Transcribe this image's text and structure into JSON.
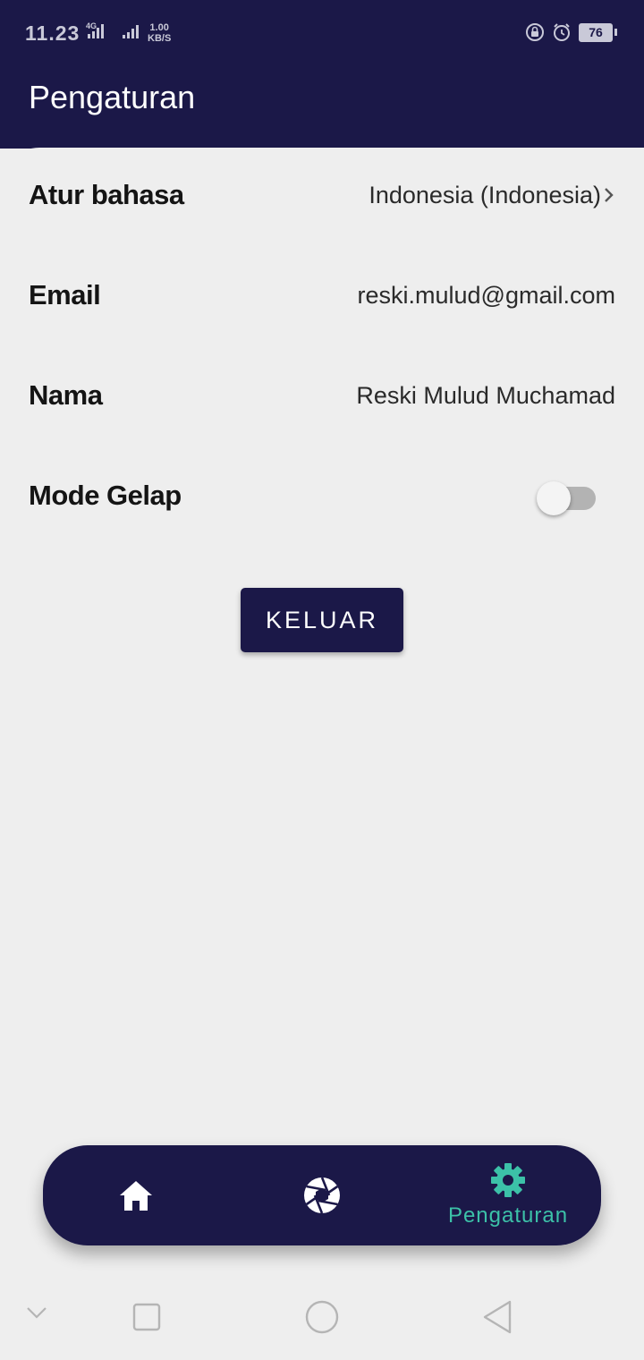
{
  "status_bar": {
    "time": "11.23",
    "network": "4G",
    "speed_value": "1.00",
    "speed_unit": "KB/S",
    "battery": "76"
  },
  "header": {
    "title": "Pengaturan"
  },
  "settings": {
    "language": {
      "label": "Atur bahasa",
      "value": "Indonesia (Indonesia)"
    },
    "email": {
      "label": "Email",
      "value": "reski.mulud@gmail.com"
    },
    "name": {
      "label": "Nama",
      "value": "Reski Mulud Muchamad"
    },
    "dark_mode": {
      "label": "Mode Gelap",
      "enabled": false
    }
  },
  "logout_label": "KELUAR",
  "bottom_nav": {
    "items": [
      {
        "icon": "home-icon",
        "label": ""
      },
      {
        "icon": "camera-aperture-icon",
        "label": ""
      },
      {
        "icon": "gear-icon",
        "label": "Pengaturan",
        "active": true
      }
    ]
  },
  "colors": {
    "primary": "#1b1848",
    "accent": "#3cc1a8",
    "background": "#eeeeee"
  }
}
